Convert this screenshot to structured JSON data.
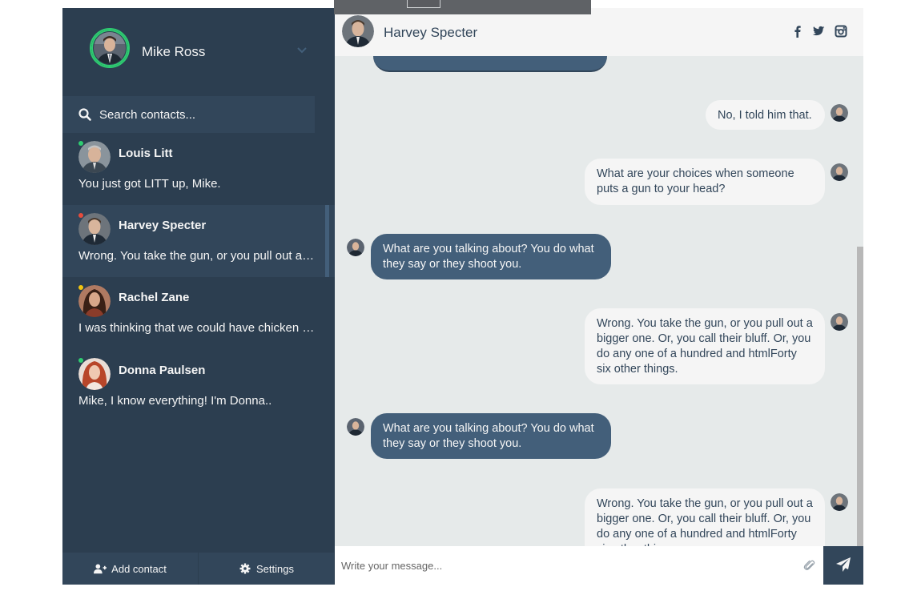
{
  "profile": {
    "name": "Mike Ross",
    "status_color": "#2ecc71"
  },
  "search": {
    "placeholder": "Search contacts..."
  },
  "contacts": [
    {
      "name": "Louis Litt",
      "preview": "You just got LITT up, Mike.",
      "status": "online",
      "status_color": "#2ecc71"
    },
    {
      "name": "Harvey Specter",
      "preview": "Wrong. You take the gun, or you pull out a bigger one. Or, you call their bluff.",
      "status": "busy",
      "status_color": "#e74c3c",
      "active": true
    },
    {
      "name": "Rachel Zane",
      "preview": "I was thinking that we could have chicken tonight, sounds good?",
      "status": "away",
      "status_color": "#f1c40f"
    },
    {
      "name": "Donna Paulsen",
      "preview": "Mike, I know everything! I'm Donna..",
      "status": "online",
      "status_color": "#2ecc71"
    }
  ],
  "bottom_bar": {
    "add_contact": "Add contact",
    "settings": "Settings"
  },
  "chat": {
    "contact_name": "Harvey Specter",
    "social": [
      "facebook-icon",
      "twitter-icon",
      "instagram-icon"
    ],
    "messages": [
      {
        "type": "replies",
        "text": "No, I told him that."
      },
      {
        "type": "replies",
        "text": "What are your choices when someone puts a gun to your head?"
      },
      {
        "type": "sent",
        "text": "What are you talking about? You do what they say or they shoot you."
      },
      {
        "type": "replies",
        "text": "Wrong. You take the gun, or you pull out a bigger one. Or, you call their bluff. Or, you do any one of a hundred and htmlForty six other things."
      },
      {
        "type": "sent",
        "text": "What are you talking about? You do what they say or they shoot you."
      },
      {
        "type": "replies",
        "text": "Wrong. You take the gun, or you pull out a bigger one. Or, you call their bluff. Or, you do any one of a hundred and htmlForty six other things."
      }
    ],
    "input_placeholder": "Write your message..."
  },
  "colors": {
    "sidebar": "#2c3e50",
    "sidebar_active": "#32465a",
    "accent": "#435f7a",
    "chat_bg": "#e6eaea",
    "bubble_light": "#f5f5f5"
  }
}
